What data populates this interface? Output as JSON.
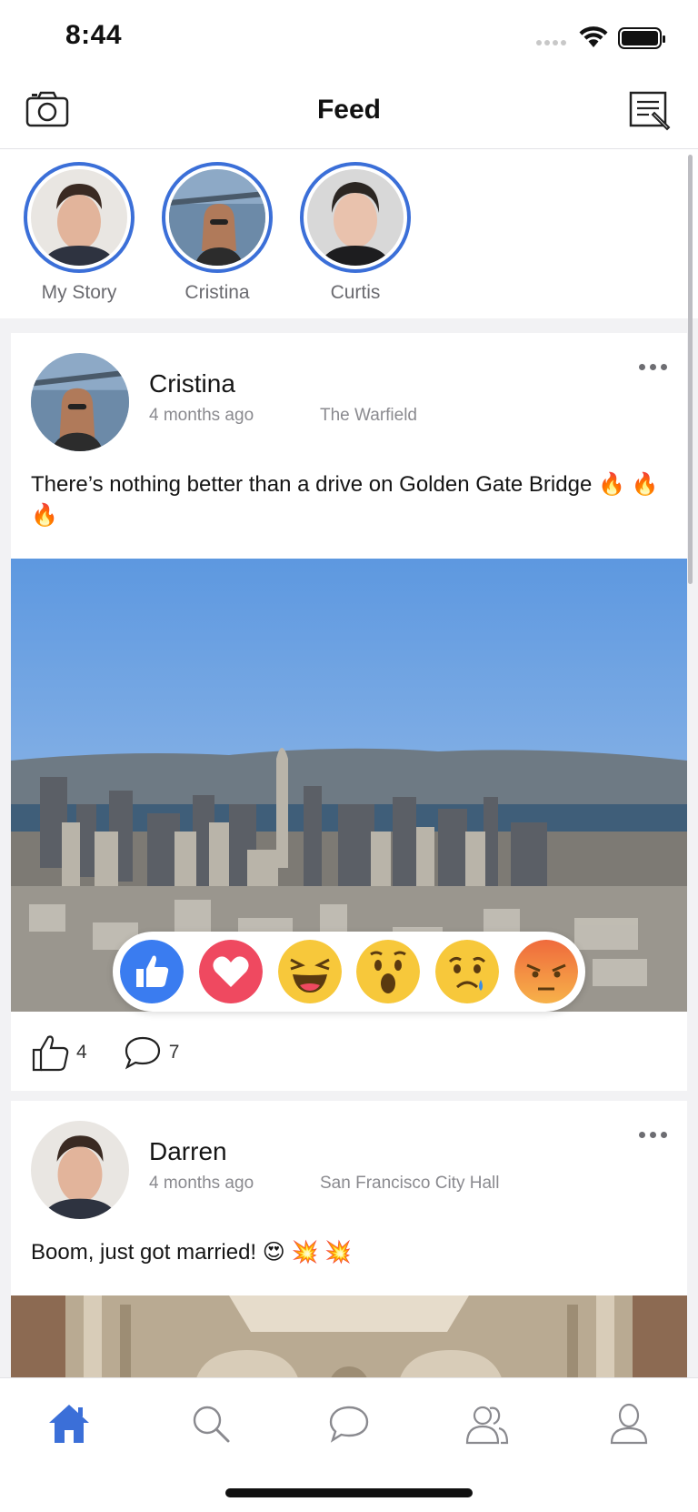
{
  "status_bar": {
    "time": "8:44"
  },
  "nav": {
    "title": "Feed",
    "left_icon": "camera-icon",
    "right_icon": "compose-icon"
  },
  "stories": [
    {
      "label": "My Story"
    },
    {
      "label": "Cristina"
    },
    {
      "label": "Curtis"
    }
  ],
  "posts": [
    {
      "author": "Cristina",
      "time": "4 months ago",
      "location": "The Warfield",
      "text": "There’s nothing better than a drive on Golden Gate Bridge 🔥 🔥 🔥",
      "likes": "4",
      "comments": "7"
    },
    {
      "author": "Darren",
      "time": "4 months ago",
      "location": "San Francisco City Hall",
      "text": "Boom, just got married! 😍 💥 💥"
    }
  ],
  "reactions": [
    "like",
    "love",
    "haha",
    "wow",
    "sad",
    "angry"
  ],
  "tab_bar": {
    "items": [
      "home",
      "search",
      "messages",
      "friends",
      "profile"
    ],
    "active": "home"
  },
  "colors": {
    "accent": "#3b6fd8",
    "like_blue": "#3a7cf0",
    "love_red": "#ef4960",
    "emoji_yellow": "#f7c83b",
    "angry_orange": "#ef7e47",
    "text_secondary": "#8a8a8f"
  }
}
